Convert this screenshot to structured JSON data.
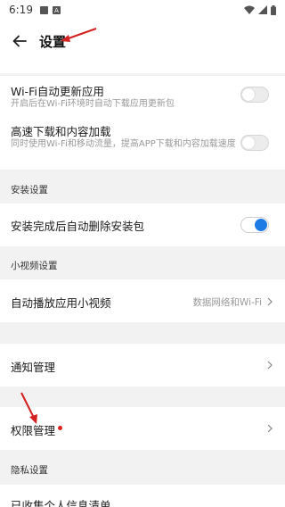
{
  "status": {
    "time": "6:19"
  },
  "appbar": {
    "title": "设置"
  },
  "wifi_update": {
    "label": "Wi-Fi自动更新应用",
    "sub": "开启后在Wi-Fi环境时自动下载应用更新包",
    "toggle": "off"
  },
  "fast_download": {
    "label": "高速下载和内容加载",
    "sub": "同时使用Wi-Fi和移动流量，提高APP下载和内容加载速度",
    "toggle": "off"
  },
  "install_settings": {
    "header": "安装设置",
    "auto_delete": {
      "label": "安装完成后自动删除安装包",
      "toggle": "on"
    }
  },
  "video_settings": {
    "header": "小视频设置",
    "autoplay": {
      "label": "自动播放应用小视频",
      "value": "数据网络和Wi-Fi"
    }
  },
  "notification": {
    "label": "通知管理"
  },
  "permission": {
    "label": "权限管理"
  },
  "privacy": {
    "header": "隐私设置",
    "collected_info": {
      "label": "已收集个人信息清单"
    }
  },
  "colors": {
    "accent": "#1e7be6",
    "annotation": "#d42020",
    "badge": "#e0201a"
  }
}
